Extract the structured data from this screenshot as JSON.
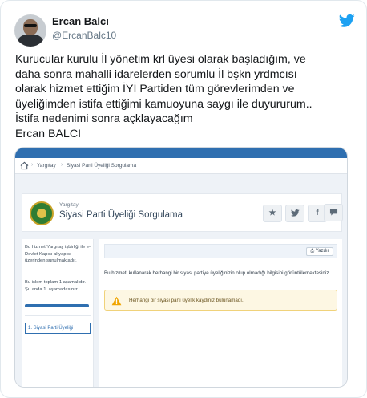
{
  "tweet": {
    "display_name": "Ercan Balcı",
    "handle": "@ErcanBalc10",
    "text": "Kurucular kurulu İl yönetim krl üyesi olarak başladığım, ve\ndaha sonra mahalli idarelerden sorumlu İl bşkn yrdmcısı\nolarak  hizmet ettiğim İYİ Partiden tüm görevlerimden ve\nüyeliğimden istifa ettiğimi kamuoyuna saygı ile duyururum..\nİstifa nedenimi sonra açklayacağım\nErcan BALCI",
    "brand_icon": "twitter-bird-icon",
    "brand_color": "#1da1f2"
  },
  "screenshot": {
    "breadcrumb": [
      "Yargıtay",
      "Siyasi Parti Üyeliği Sorgulama"
    ],
    "institution_small": "Yargıtay",
    "institution_title": "Siyasi Parti Üyeliği Sorgulama",
    "share_buttons": [
      {
        "icon": "star-icon",
        "glyph": "★"
      },
      {
        "icon": "twitter-icon",
        "glyph": "🐦"
      },
      {
        "icon": "facebook-icon",
        "glyph": "f"
      },
      {
        "icon": "comment-icon",
        "glyph": "💬"
      }
    ],
    "sidebar_info": "Bu hizmet Yargıtay işbirliği ile e-Devlet Kapısı altyapısı üzerinden sunulmaktadır.",
    "sidebar_steps": "Bu işlem toplam 1 aşamalıdır. Şu anda 1. aşamadasınız.",
    "progress": 1.0,
    "step_label": "1. Siyasi Parti Üyeliği",
    "print_label": "Yazdır",
    "info_text": "Bu hizmeti kullanarak herhangi bir siyasi partiye üyeliğinizin olup olmadığı bilgisini görüntülemektesiniz.",
    "warning_text": "Herhangi bir siyasi parti üyelik kaydınız bulunamadı.",
    "accent_color": "#2f6fb0",
    "warning_color": "#f0a500"
  }
}
